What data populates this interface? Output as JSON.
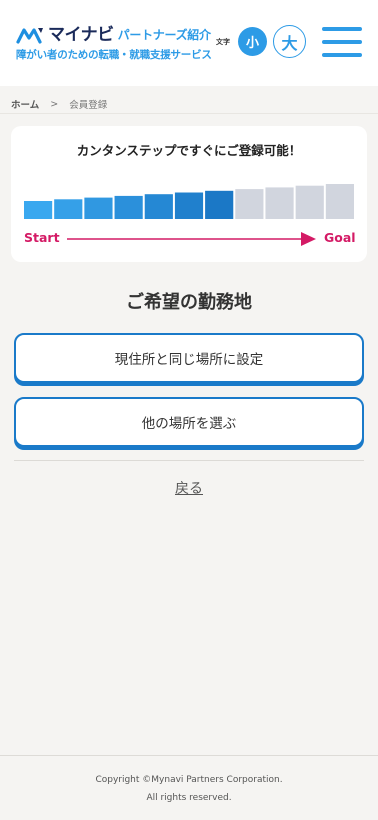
{
  "header": {
    "logo_main": "マイナビ",
    "logo_sub": "パートナーズ紹介",
    "tagline": "障がい者のための転職・就職支援サービス",
    "font_size_label": "文字",
    "font_small": "小",
    "font_large": "大"
  },
  "breadcrumb": {
    "home": "ホーム",
    "separator": ">",
    "current": "会員登録"
  },
  "progress": {
    "title": "カンタンステップですぐにご登録可能！",
    "total_steps": 11,
    "completed_steps": 7,
    "start_label": "Start",
    "goal_label": "Goal",
    "colors": {
      "done_light": "#3aa8ef",
      "done_dark": "#1b78c6",
      "pending": "#d1d5de",
      "arrow": "#d41a65"
    }
  },
  "main": {
    "section_title": "ご希望の勤務地",
    "options": [
      {
        "label": "現住所と同じ場所に設定"
      },
      {
        "label": "他の場所を選ぶ"
      }
    ],
    "back_label": "戻る"
  },
  "footer": {
    "copyright": "Copyright ©Mynavi Partners Corporation.",
    "rights": "All rights reserved."
  },
  "colors": {
    "accent": "#2d9be6",
    "button_border": "#1a7ac9",
    "background": "#f5f4f2"
  }
}
